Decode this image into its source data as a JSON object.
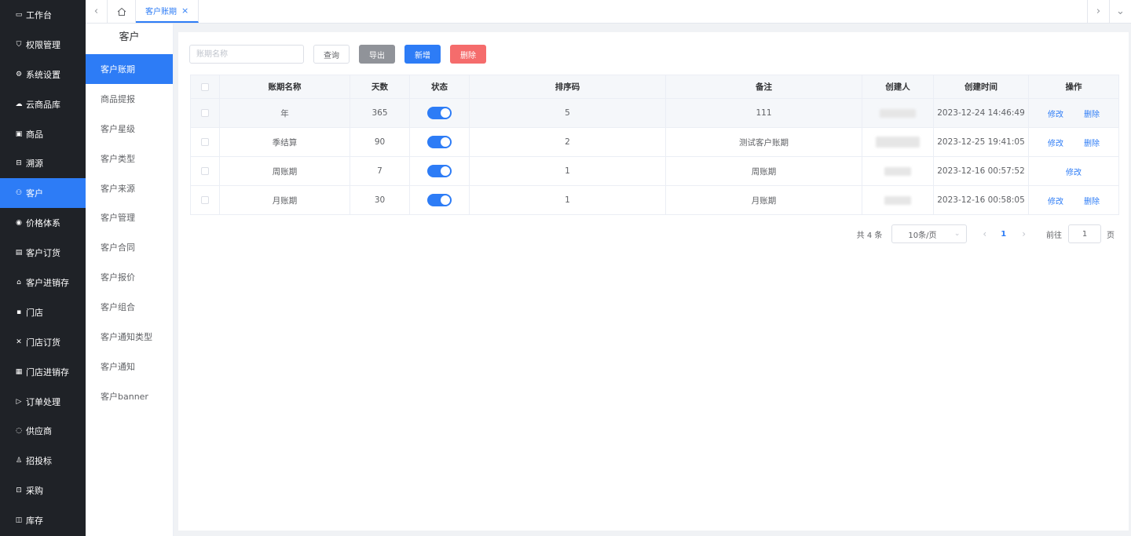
{
  "nav": [
    {
      "label": "工作台",
      "icon": "monitor-icon"
    },
    {
      "label": "权限管理",
      "icon": "shield-icon"
    },
    {
      "label": "系统设置",
      "icon": "gear-icon"
    },
    {
      "label": "云商品库",
      "icon": "cloud-icon"
    },
    {
      "label": "商品",
      "icon": "box-icon"
    },
    {
      "label": "溯源",
      "icon": "trace-icon"
    },
    {
      "label": "客户",
      "icon": "users-icon",
      "active": true
    },
    {
      "label": "价格体系",
      "icon": "price-icon"
    },
    {
      "label": "客户订货",
      "icon": "order-icon"
    },
    {
      "label": "客户进销存",
      "icon": "bank-icon"
    },
    {
      "label": "门店",
      "icon": "store-icon"
    },
    {
      "label": "门店订货",
      "icon": "store-order-icon"
    },
    {
      "label": "门店进销存",
      "icon": "inventory-icon"
    },
    {
      "label": "订单处理",
      "icon": "send-icon"
    },
    {
      "label": "供应商",
      "icon": "supplier-icon"
    },
    {
      "label": "招投标",
      "icon": "person-icon"
    },
    {
      "label": "采购",
      "icon": "purchase-icon"
    },
    {
      "label": "库存",
      "icon": "stock-icon"
    }
  ],
  "submenu": {
    "title": "客户",
    "items": [
      "客户账期",
      "商品提报",
      "客户星级",
      "客户类型",
      "客户来源",
      "客户管理",
      "客户合同",
      "客户报价",
      "客户组合",
      "客户通知类型",
      "客户通知",
      "客户banner"
    ]
  },
  "tabs": {
    "active_label": "客户账期",
    "close": "×"
  },
  "toolbar": {
    "search_placeholder": "账期名称",
    "query_label": "查询",
    "export_label": "导出",
    "add_label": "新增",
    "delete_label": "删除"
  },
  "table": {
    "headers": [
      "账期名称",
      "天数",
      "状态",
      "排序码",
      "备注",
      "创建人",
      "创建时间",
      "操作"
    ],
    "rows": [
      {
        "name": "年",
        "days": "365",
        "sort": "5",
        "remark": "111",
        "created": "2023-12-24 14:46:49",
        "ops": [
          "修改",
          "删除"
        ]
      },
      {
        "name": "季结算",
        "days": "90",
        "sort": "2",
        "remark": "测试客户账期",
        "created": "2023-12-25 19:41:05",
        "ops": [
          "修改",
          "删除"
        ]
      },
      {
        "name": "周账期",
        "days": "7",
        "sort": "1",
        "remark": "周账期",
        "created": "2023-12-16 00:57:52",
        "ops": [
          "修改"
        ]
      },
      {
        "name": "月账期",
        "days": "30",
        "sort": "1",
        "remark": "月账期",
        "created": "2023-12-16 00:58:05",
        "ops": [
          "修改",
          "删除"
        ]
      }
    ]
  },
  "pagination": {
    "total": "共 4 条",
    "page_size": "10条/页",
    "current": "1",
    "goto_label": "前往",
    "goto_value": "1",
    "page_unit": "页"
  },
  "colors": {
    "primary": "#2d7cf6",
    "danger": "#f56c6c",
    "nav_bg": "#1f2227"
  }
}
